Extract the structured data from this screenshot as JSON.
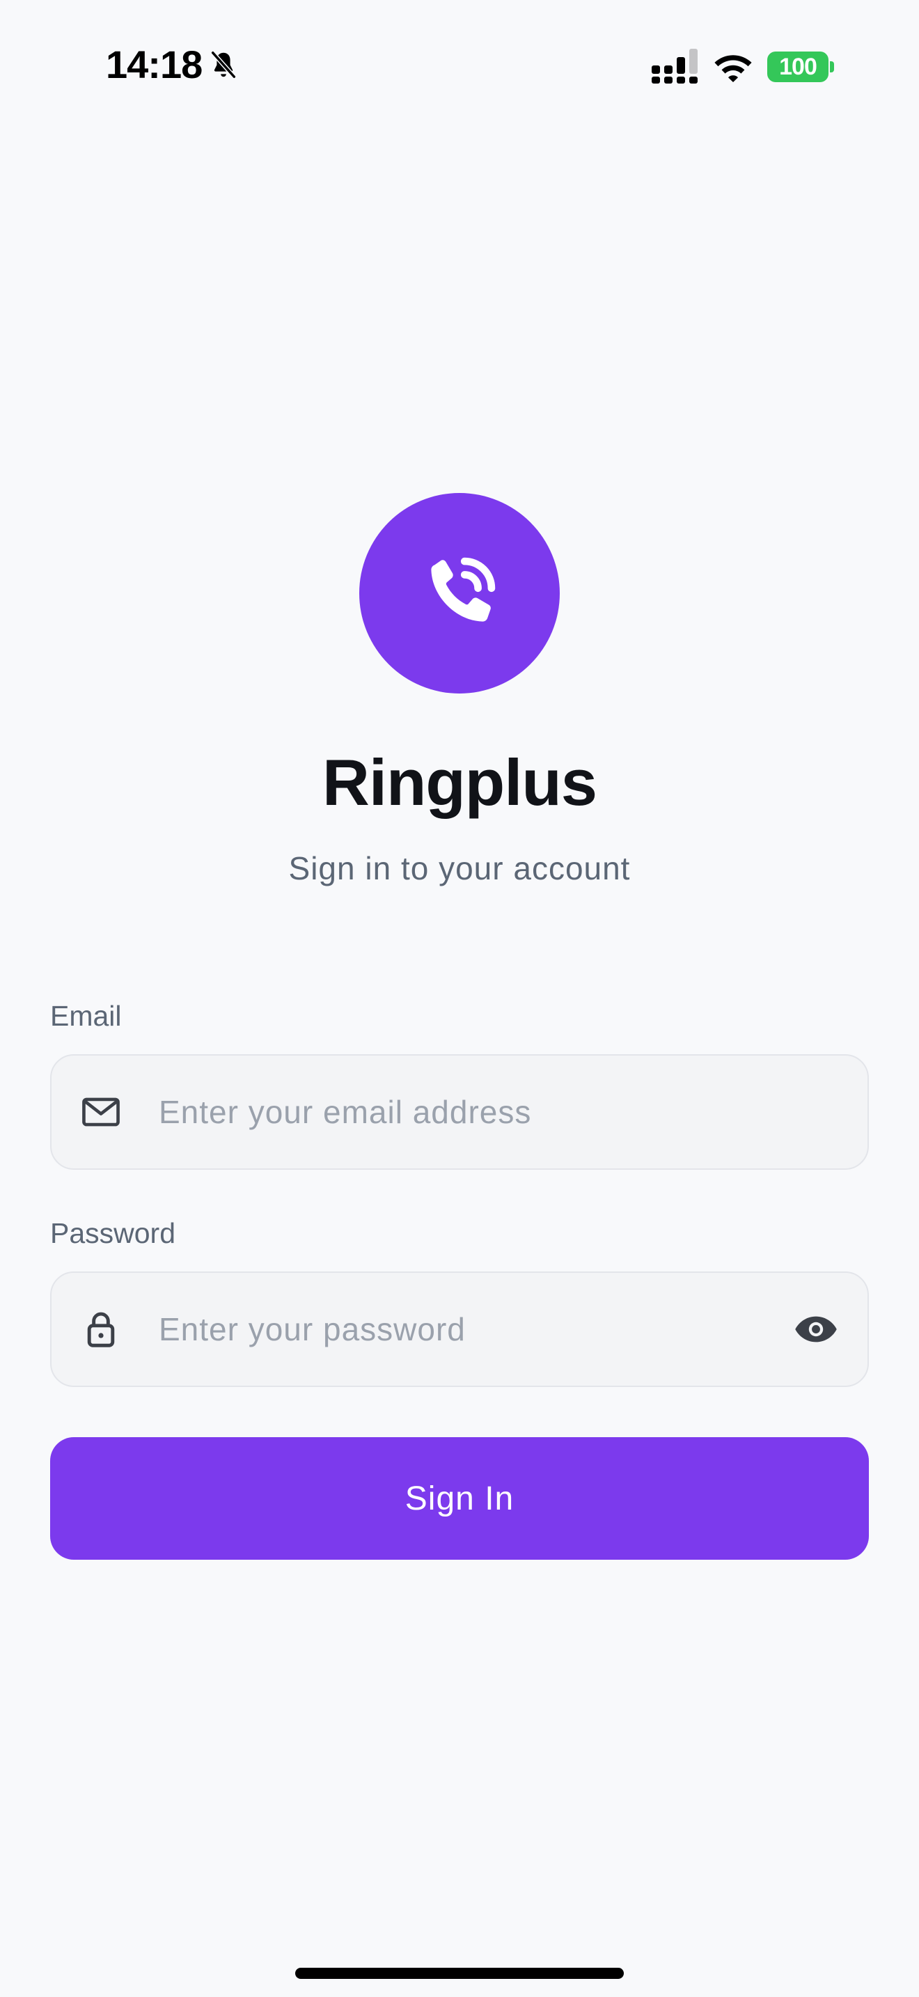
{
  "status_bar": {
    "time": "14:18",
    "battery": "100",
    "icons": [
      "bell-off-icon",
      "signal-icon",
      "wifi-icon",
      "battery-icon"
    ],
    "battery_color": "#34c759"
  },
  "app": {
    "title": "Ringplus",
    "subtitle": "Sign in to your account",
    "logo_icon": "phone-call-icon",
    "accent_color": "#7c3aed"
  },
  "form": {
    "email": {
      "label": "Email",
      "placeholder": "Enter your email address",
      "value": "",
      "icon": "mail-icon"
    },
    "password": {
      "label": "Password",
      "placeholder": "Enter your password",
      "value": "",
      "icon": "lock-icon",
      "toggle_icon": "eye-icon"
    },
    "submit_label": "Sign In"
  }
}
